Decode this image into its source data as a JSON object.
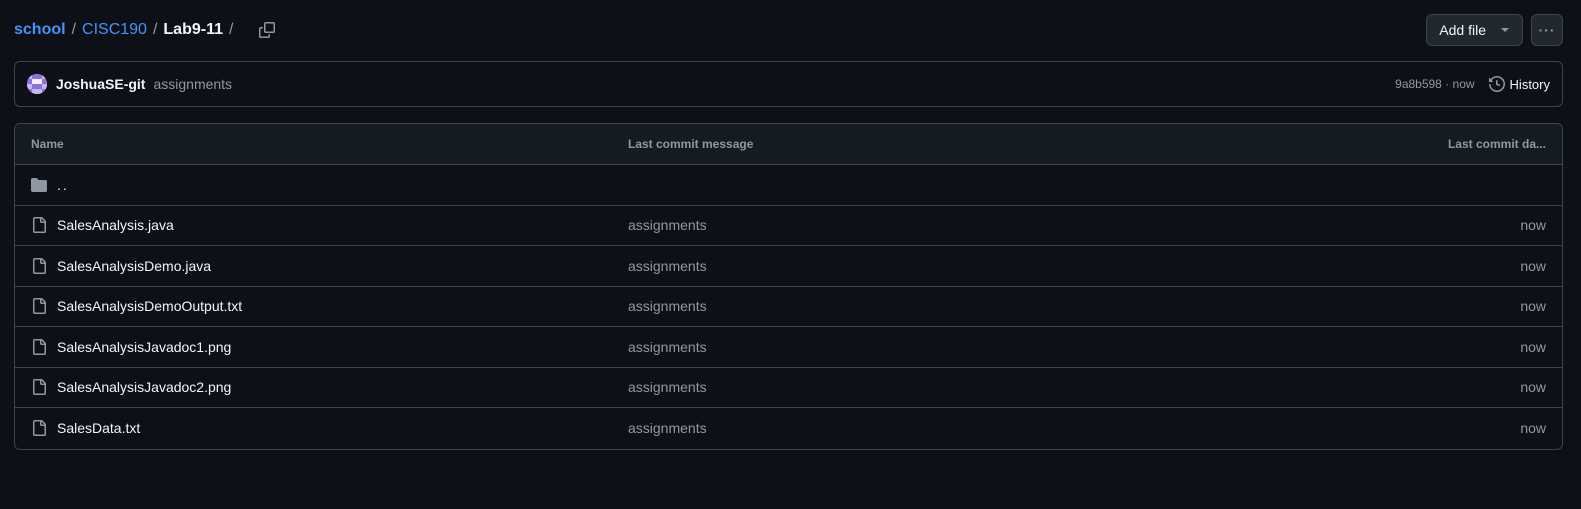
{
  "breadcrumb": {
    "root": "school",
    "parent": "CISC190",
    "current": "Lab9-11",
    "sep": "/"
  },
  "toolbar": {
    "add_file_label": "Add file",
    "more_label": "···"
  },
  "commit": {
    "author": "JoshuaSE-git",
    "message": "assignments",
    "sha_time": "9a8b598 · now",
    "history_label": "History"
  },
  "table": {
    "headers": {
      "name": "Name",
      "message": "Last commit message",
      "date": "Last commit da..."
    },
    "parent_dir": "..",
    "rows": [
      {
        "name": "SalesAnalysis.java",
        "message": "assignments",
        "date": "now"
      },
      {
        "name": "SalesAnalysisDemo.java",
        "message": "assignments",
        "date": "now"
      },
      {
        "name": "SalesAnalysisDemoOutput.txt",
        "message": "assignments",
        "date": "now"
      },
      {
        "name": "SalesAnalysisJavadoc1.png",
        "message": "assignments",
        "date": "now"
      },
      {
        "name": "SalesAnalysisJavadoc2.png",
        "message": "assignments",
        "date": "now"
      },
      {
        "name": "SalesData.txt",
        "message": "assignments",
        "date": "now"
      }
    ]
  },
  "colors": {
    "background": "#0d1117",
    "link": "#4493f8",
    "border": "#3d444d",
    "muted": "#9198a1"
  }
}
